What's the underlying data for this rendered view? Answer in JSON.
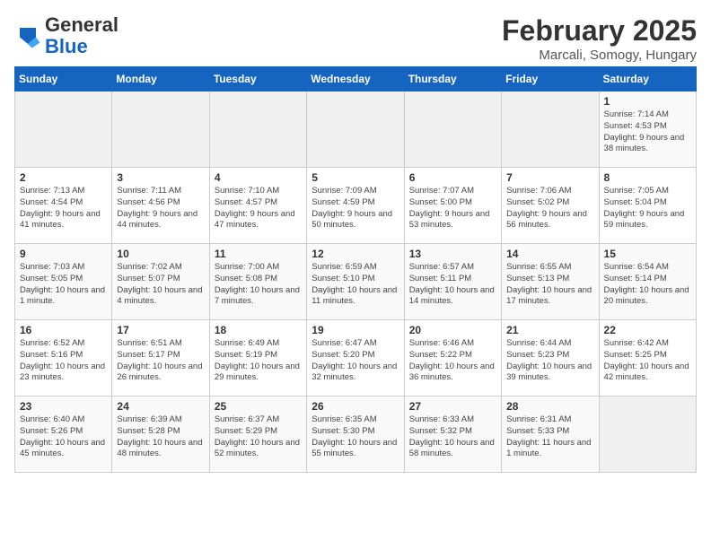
{
  "app": {
    "name_general": "General",
    "name_blue": "Blue"
  },
  "header": {
    "title": "February 2025",
    "subtitle": "Marcali, Somogy, Hungary"
  },
  "days_of_week": [
    "Sunday",
    "Monday",
    "Tuesday",
    "Wednesday",
    "Thursday",
    "Friday",
    "Saturday"
  ],
  "weeks": [
    [
      {
        "day": "",
        "empty": true
      },
      {
        "day": "",
        "empty": true
      },
      {
        "day": "",
        "empty": true
      },
      {
        "day": "",
        "empty": true
      },
      {
        "day": "",
        "empty": true
      },
      {
        "day": "",
        "empty": true
      },
      {
        "day": "1",
        "sunrise": "Sunrise: 7:14 AM",
        "sunset": "Sunset: 4:53 PM",
        "daylight": "Daylight: 9 hours and 38 minutes."
      }
    ],
    [
      {
        "day": "2",
        "sunrise": "Sunrise: 7:13 AM",
        "sunset": "Sunset: 4:54 PM",
        "daylight": "Daylight: 9 hours and 41 minutes."
      },
      {
        "day": "3",
        "sunrise": "Sunrise: 7:11 AM",
        "sunset": "Sunset: 4:56 PM",
        "daylight": "Daylight: 9 hours and 44 minutes."
      },
      {
        "day": "4",
        "sunrise": "Sunrise: 7:10 AM",
        "sunset": "Sunset: 4:57 PM",
        "daylight": "Daylight: 9 hours and 47 minutes."
      },
      {
        "day": "5",
        "sunrise": "Sunrise: 7:09 AM",
        "sunset": "Sunset: 4:59 PM",
        "daylight": "Daylight: 9 hours and 50 minutes."
      },
      {
        "day": "6",
        "sunrise": "Sunrise: 7:07 AM",
        "sunset": "Sunset: 5:00 PM",
        "daylight": "Daylight: 9 hours and 53 minutes."
      },
      {
        "day": "7",
        "sunrise": "Sunrise: 7:06 AM",
        "sunset": "Sunset: 5:02 PM",
        "daylight": "Daylight: 9 hours and 56 minutes."
      },
      {
        "day": "8",
        "sunrise": "Sunrise: 7:05 AM",
        "sunset": "Sunset: 5:04 PM",
        "daylight": "Daylight: 9 hours and 59 minutes."
      }
    ],
    [
      {
        "day": "9",
        "sunrise": "Sunrise: 7:03 AM",
        "sunset": "Sunset: 5:05 PM",
        "daylight": "Daylight: 10 hours and 1 minute."
      },
      {
        "day": "10",
        "sunrise": "Sunrise: 7:02 AM",
        "sunset": "Sunset: 5:07 PM",
        "daylight": "Daylight: 10 hours and 4 minutes."
      },
      {
        "day": "11",
        "sunrise": "Sunrise: 7:00 AM",
        "sunset": "Sunset: 5:08 PM",
        "daylight": "Daylight: 10 hours and 7 minutes."
      },
      {
        "day": "12",
        "sunrise": "Sunrise: 6:59 AM",
        "sunset": "Sunset: 5:10 PM",
        "daylight": "Daylight: 10 hours and 11 minutes."
      },
      {
        "day": "13",
        "sunrise": "Sunrise: 6:57 AM",
        "sunset": "Sunset: 5:11 PM",
        "daylight": "Daylight: 10 hours and 14 minutes."
      },
      {
        "day": "14",
        "sunrise": "Sunrise: 6:55 AM",
        "sunset": "Sunset: 5:13 PM",
        "daylight": "Daylight: 10 hours and 17 minutes."
      },
      {
        "day": "15",
        "sunrise": "Sunrise: 6:54 AM",
        "sunset": "Sunset: 5:14 PM",
        "daylight": "Daylight: 10 hours and 20 minutes."
      }
    ],
    [
      {
        "day": "16",
        "sunrise": "Sunrise: 6:52 AM",
        "sunset": "Sunset: 5:16 PM",
        "daylight": "Daylight: 10 hours and 23 minutes."
      },
      {
        "day": "17",
        "sunrise": "Sunrise: 6:51 AM",
        "sunset": "Sunset: 5:17 PM",
        "daylight": "Daylight: 10 hours and 26 minutes."
      },
      {
        "day": "18",
        "sunrise": "Sunrise: 6:49 AM",
        "sunset": "Sunset: 5:19 PM",
        "daylight": "Daylight: 10 hours and 29 minutes."
      },
      {
        "day": "19",
        "sunrise": "Sunrise: 6:47 AM",
        "sunset": "Sunset: 5:20 PM",
        "daylight": "Daylight: 10 hours and 32 minutes."
      },
      {
        "day": "20",
        "sunrise": "Sunrise: 6:46 AM",
        "sunset": "Sunset: 5:22 PM",
        "daylight": "Daylight: 10 hours and 36 minutes."
      },
      {
        "day": "21",
        "sunrise": "Sunrise: 6:44 AM",
        "sunset": "Sunset: 5:23 PM",
        "daylight": "Daylight: 10 hours and 39 minutes."
      },
      {
        "day": "22",
        "sunrise": "Sunrise: 6:42 AM",
        "sunset": "Sunset: 5:25 PM",
        "daylight": "Daylight: 10 hours and 42 minutes."
      }
    ],
    [
      {
        "day": "23",
        "sunrise": "Sunrise: 6:40 AM",
        "sunset": "Sunset: 5:26 PM",
        "daylight": "Daylight: 10 hours and 45 minutes."
      },
      {
        "day": "24",
        "sunrise": "Sunrise: 6:39 AM",
        "sunset": "Sunset: 5:28 PM",
        "daylight": "Daylight: 10 hours and 48 minutes."
      },
      {
        "day": "25",
        "sunrise": "Sunrise: 6:37 AM",
        "sunset": "Sunset: 5:29 PM",
        "daylight": "Daylight: 10 hours and 52 minutes."
      },
      {
        "day": "26",
        "sunrise": "Sunrise: 6:35 AM",
        "sunset": "Sunset: 5:30 PM",
        "daylight": "Daylight: 10 hours and 55 minutes."
      },
      {
        "day": "27",
        "sunrise": "Sunrise: 6:33 AM",
        "sunset": "Sunset: 5:32 PM",
        "daylight": "Daylight: 10 hours and 58 minutes."
      },
      {
        "day": "28",
        "sunrise": "Sunrise: 6:31 AM",
        "sunset": "Sunset: 5:33 PM",
        "daylight": "Daylight: 11 hours and 1 minute."
      },
      {
        "day": "",
        "empty": true
      }
    ]
  ]
}
